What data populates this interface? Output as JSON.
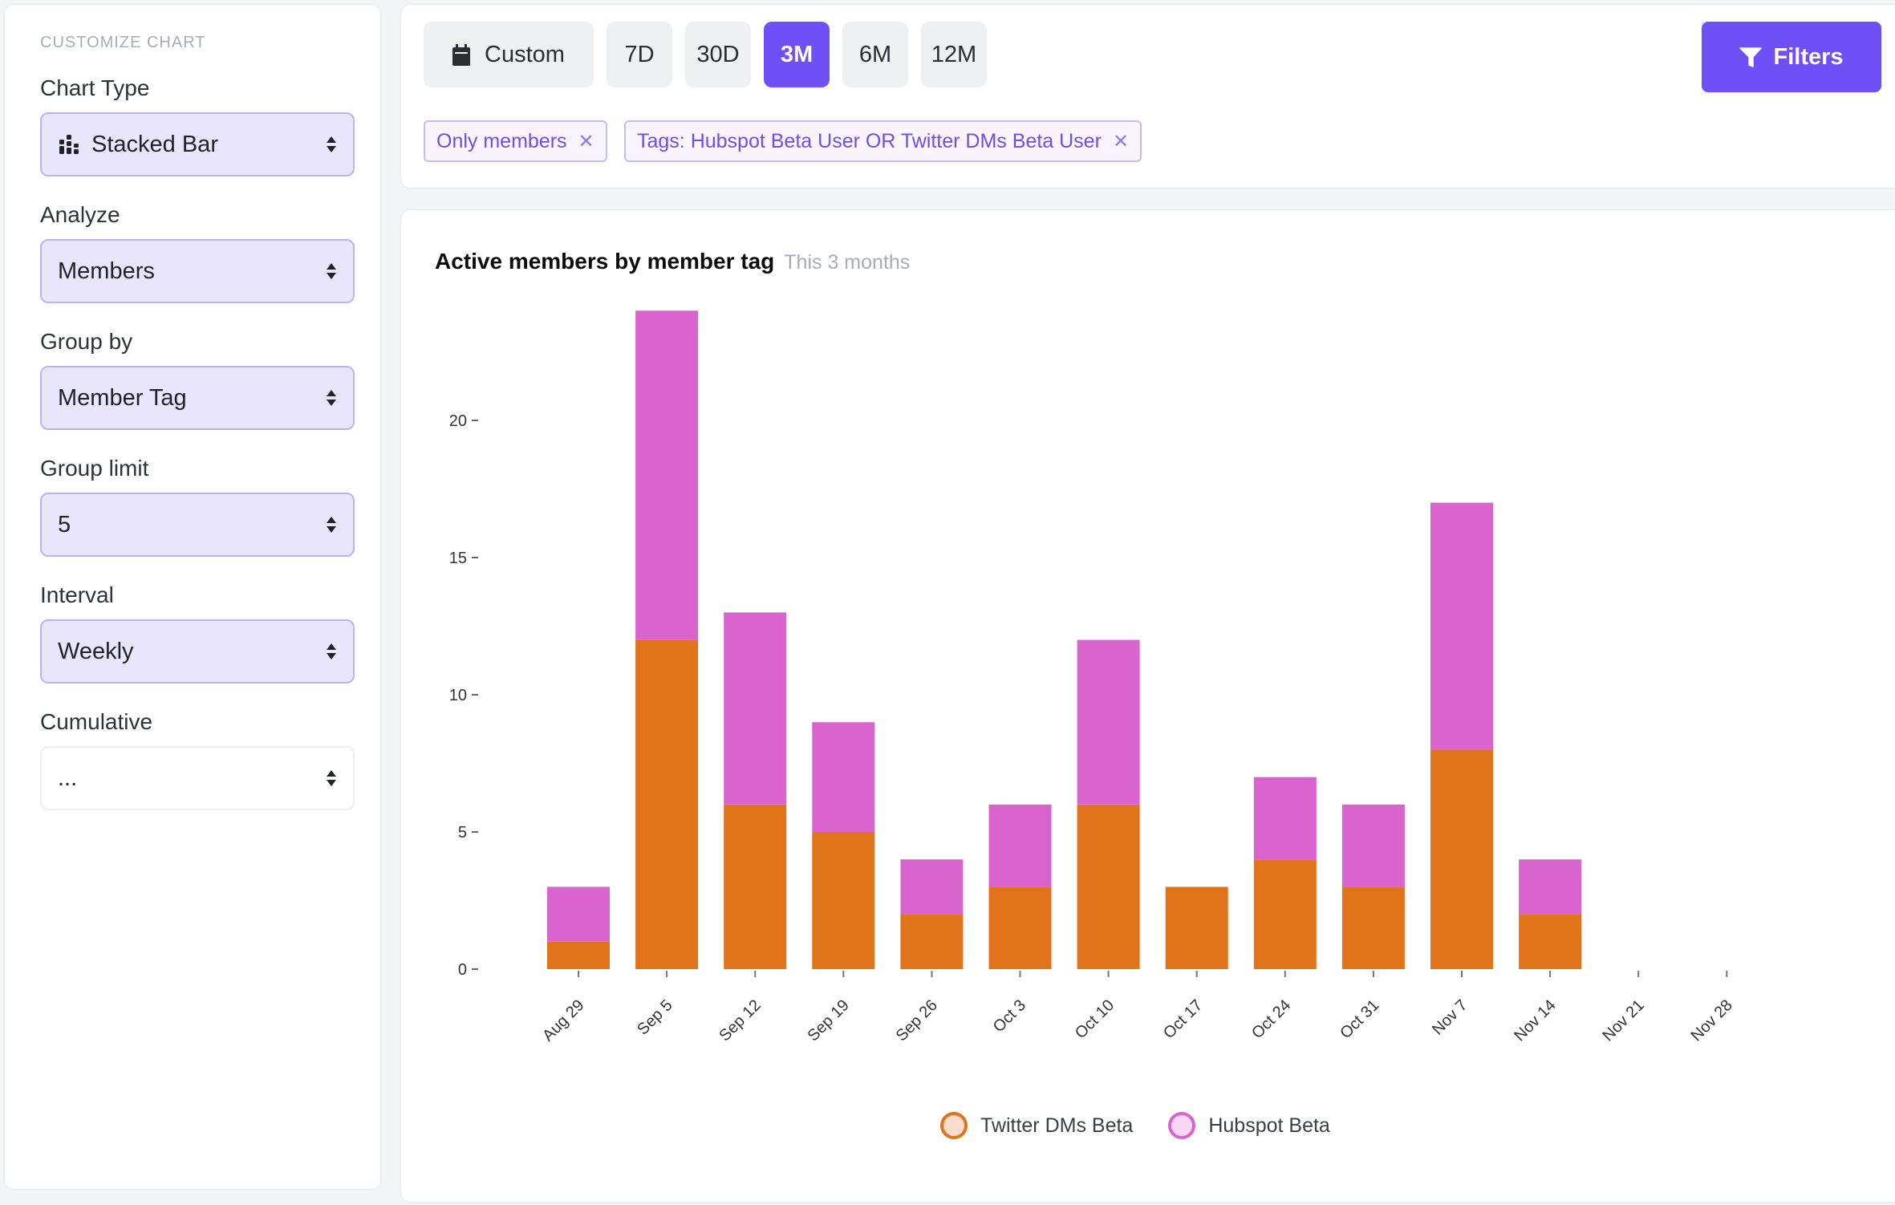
{
  "sidebar": {
    "heading": "Customize chart",
    "fields": [
      {
        "label": "Chart Type",
        "value": "Stacked Bar",
        "icon": "stacked-bar-icon"
      },
      {
        "label": "Analyze",
        "value": "Members"
      },
      {
        "label": "Group by",
        "value": "Member Tag"
      },
      {
        "label": "Group limit",
        "value": "5"
      },
      {
        "label": "Interval",
        "value": "Weekly"
      },
      {
        "label": "Cumulative",
        "value": "..."
      }
    ]
  },
  "toolbar": {
    "ranges": [
      {
        "label": "Custom",
        "icon": "calendar-icon",
        "active": false
      },
      {
        "label": "7D",
        "active": false
      },
      {
        "label": "30D",
        "active": false
      },
      {
        "label": "3M",
        "active": true
      },
      {
        "label": "6M",
        "active": false
      },
      {
        "label": "12M",
        "active": false
      }
    ],
    "filters_label": "Filters",
    "chips": [
      {
        "label": "Only members",
        "remove": "✕"
      },
      {
        "label": "Tags: Hubspot Beta User OR Twitter DMs Beta User",
        "remove": "✕"
      }
    ]
  },
  "colors": {
    "accent": "#6f4ff6",
    "twitter": "#e1731a",
    "hubspot": "#d964cd"
  },
  "chart_data": {
    "type": "bar",
    "stacked": true,
    "title": "Active members by member tag",
    "subtitle": "This 3 months",
    "xlabel": "",
    "ylabel": "",
    "ylim": [
      0,
      24
    ],
    "yticks": [
      0,
      5,
      10,
      15,
      20
    ],
    "grid": false,
    "legend_position": "bottom-center",
    "categories": [
      "Aug 29",
      "Sep 5",
      "Sep 12",
      "Sep 19",
      "Sep 26",
      "Oct 3",
      "Oct 10",
      "Oct 17",
      "Oct 24",
      "Oct 31",
      "Nov 7",
      "Nov 14",
      "Nov 21",
      "Nov 28"
    ],
    "series": [
      {
        "name": "Twitter DMs Beta",
        "color": "#e1731a",
        "fill": "#fadccc",
        "values": [
          1,
          12,
          6,
          5,
          2,
          3,
          6,
          3,
          4,
          3,
          8,
          2,
          0,
          0
        ]
      },
      {
        "name": "Hubspot Beta",
        "color": "#d964cd",
        "fill": "#f8d8f4",
        "values": [
          2,
          12,
          7,
          4,
          2,
          3,
          6,
          0,
          3,
          3,
          9,
          2,
          0,
          0
        ]
      }
    ]
  }
}
